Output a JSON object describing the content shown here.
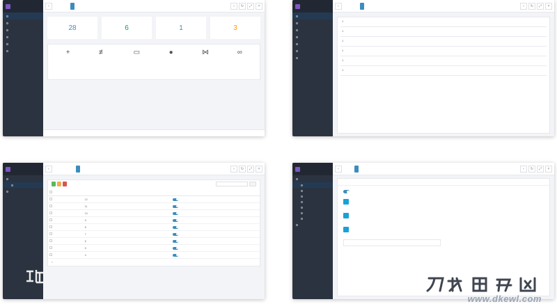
{
  "dashboard": {
    "stats": [
      {
        "value": "28",
        "color": "#3c8dbc"
      },
      {
        "value": "6",
        "color": "#00a65a"
      },
      {
        "value": "1",
        "color": "#3c8dbc"
      },
      {
        "value": "3",
        "color": "#f39c12"
      }
    ]
  },
  "config": {
    "field_values": [
      "1",
      "1",
      "1",
      "1",
      "1",
      "1"
    ]
  },
  "table": {
    "footer_page": "1",
    "id_values": [
      "12",
      "11",
      "10",
      "9",
      "8",
      "7",
      "6",
      "5",
      "4"
    ]
  },
  "watermark": {
    "title": "刀客源码网",
    "url": "www.dkewl.com"
  }
}
